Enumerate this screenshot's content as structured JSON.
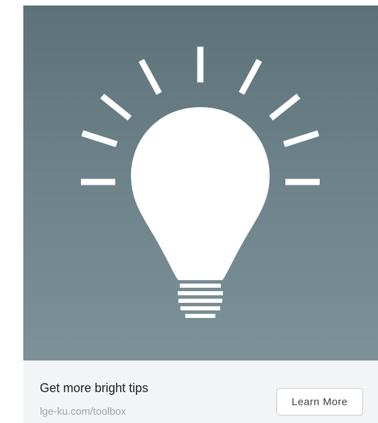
{
  "ad": {
    "headline": "Get more bright tips",
    "domain": "lge-ku.com/toolbox",
    "cta_label": "Learn More"
  },
  "image": {
    "icon": "lightbulb-icon",
    "colors": {
      "background_top": "#5c7178",
      "background_bottom": "#7d9298",
      "icon": "#ffffff"
    }
  },
  "colors": {
    "footer_background": "#f3f4f6",
    "headline_text": "#1c1e21",
    "domain_text": "#a0a4aa",
    "button_border": "#c6c9ce"
  }
}
